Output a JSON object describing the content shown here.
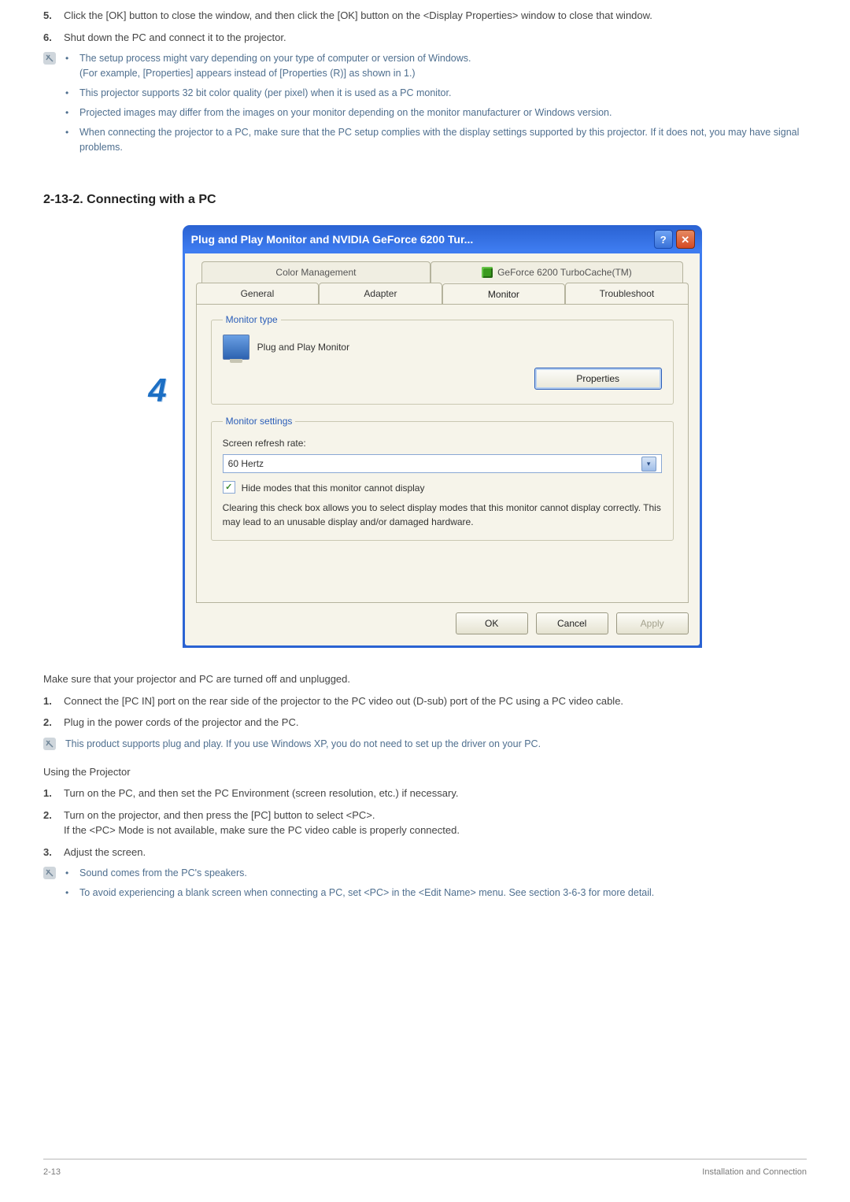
{
  "list1": {
    "5": "Click the [OK] button to close the window, and then click the [OK] button on the <Display Properties> window to close that window.",
    "6": "Shut down the PC and connect it to the projector."
  },
  "notes1": [
    {
      "a": "The setup process might vary depending on your type of computer or version of Windows.",
      "b": "(For example, [Properties] appears instead of [Properties (R)] as shown in 1.)"
    },
    {
      "a": "This projector supports 32 bit color quality (per pixel) when it is used as a PC monitor."
    },
    {
      "a": "Projected images may differ from the images on your monitor depending on the monitor manufacturer or Windows version."
    },
    {
      "a": "When connecting the projector to a PC, make sure that the PC setup complies with the display settings supported by this projector. If it does not, you may have signal problems."
    }
  ],
  "heading": "2-13-2. Connecting with a PC",
  "stepMarker": "4",
  "dialog": {
    "title": "Plug and Play Monitor and NVIDIA GeForce 6200 Tur...",
    "tabsRow1": [
      "Color Management",
      "GeForce 6200 TurboCache(TM)"
    ],
    "tabsRow2": [
      "General",
      "Adapter",
      "Monitor",
      "Troubleshoot"
    ],
    "monitorType": {
      "legend": "Monitor type",
      "name": "Plug and Play Monitor",
      "propertiesBtn": "Properties"
    },
    "monitorSettings": {
      "legend": "Monitor settings",
      "refreshLabel": "Screen refresh rate:",
      "refreshValue": "60 Hertz",
      "checkboxLabel": "Hide modes that this monitor cannot display",
      "desc": "Clearing this check box allows you to select display modes that this monitor cannot display correctly. This may lead to an unusable display and/or damaged hardware."
    },
    "buttons": {
      "ok": "OK",
      "cancel": "Cancel",
      "apply": "Apply"
    }
  },
  "para1": "Make sure that your projector and PC are turned off and unplugged.",
  "list2": {
    "1": "Connect the [PC IN] port on the rear side of the projector to the PC video out (D-sub) port of the PC using a PC video cable.",
    "2": "Plug in the power cords of the projector and the PC."
  },
  "note2": "This product supports plug and play. If you use Windows XP, you do not need to set up the driver on your PC.",
  "para2": "Using the Projector",
  "list3": {
    "1": "Turn on the PC, and then set the PC Environment (screen resolution, etc.) if necessary.",
    "2a": "Turn on the projector, and then press the [PC] button to select <PC>.",
    "2b": "If the <PC> Mode is not available, make sure the PC video cable is properly connected.",
    "3": "Adjust the screen."
  },
  "notes3": [
    {
      "a": "Sound comes from the PC's speakers."
    },
    {
      "a": "To avoid experiencing a blank screen when connecting a PC, set <PC> in the <Edit Name> menu. See section 3-6-3 for more detail."
    }
  ],
  "footer": {
    "left": "2-13",
    "right": "Installation and Connection"
  }
}
